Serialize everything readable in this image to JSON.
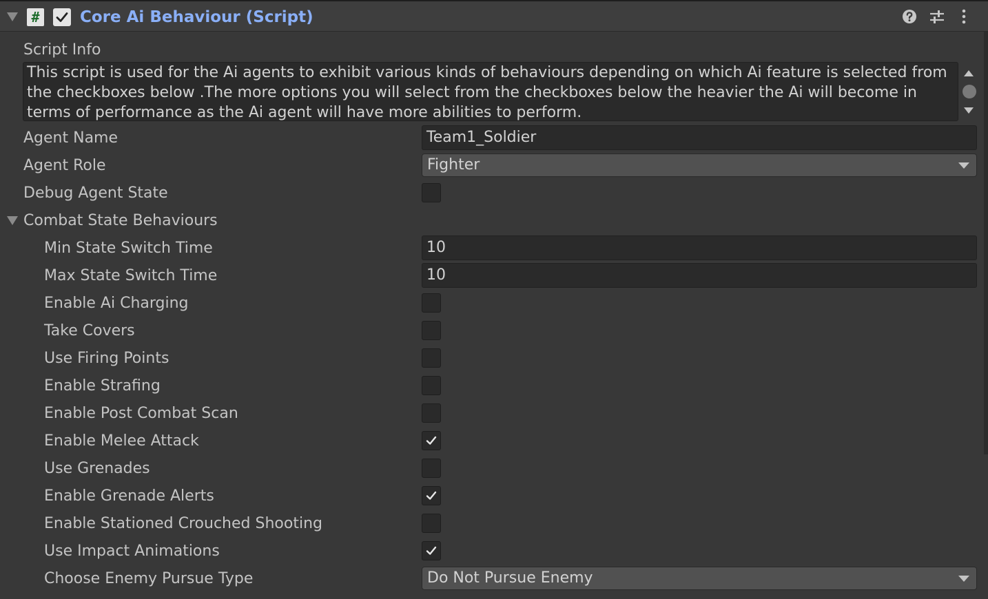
{
  "component": {
    "title": "Core Ai Behaviour (Script)",
    "enabled": true,
    "script_icon_glyph": "#",
    "icons": [
      "help-icon",
      "presets-icon",
      "more-icon"
    ]
  },
  "script_info": {
    "label": "Script Info",
    "text": "This script is used for the Ai agents to exhibit various kinds of behaviours depending on which Ai feature is selected from the checkboxes below .The more options you will select from the checkboxes below the heavier the Ai will become in terms of performance as the Ai agent will have more abilities to perform."
  },
  "agent_name": {
    "label": "Agent Name",
    "value": "Team1_Soldier"
  },
  "agent_role": {
    "label": "Agent Role",
    "value": "Fighter"
  },
  "debug_agent_state": {
    "label": "Debug Agent State",
    "checked": false
  },
  "combat": {
    "label": "Combat State Behaviours",
    "expanded": true,
    "min_switch": {
      "label": "Min State Switch Time",
      "value": "10"
    },
    "max_switch": {
      "label": "Max State Switch Time",
      "value": "10"
    },
    "toggles": [
      {
        "label": "Enable Ai Charging",
        "checked": false
      },
      {
        "label": "Take Covers",
        "checked": false
      },
      {
        "label": "Use Firing Points",
        "checked": false
      },
      {
        "label": "Enable Strafing",
        "checked": false
      },
      {
        "label": "Enable Post Combat Scan",
        "checked": false
      },
      {
        "label": "Enable Melee Attack",
        "checked": true
      },
      {
        "label": "Use Grenades",
        "checked": false
      },
      {
        "label": "Enable Grenade Alerts",
        "checked": true
      },
      {
        "label": "Enable Stationed Crouched Shooting",
        "checked": false
      },
      {
        "label": "Use Impact Animations",
        "checked": true
      }
    ],
    "pursue_type": {
      "label": "Choose Enemy Pursue Type",
      "value": "Do Not Pursue Enemy"
    }
  },
  "colors": {
    "background": "#383838",
    "header": "#3e3e3e",
    "title": "#8aaff7",
    "field": "#2a2a2a",
    "dropdown": "#515151",
    "text": "#c4c4c4"
  }
}
